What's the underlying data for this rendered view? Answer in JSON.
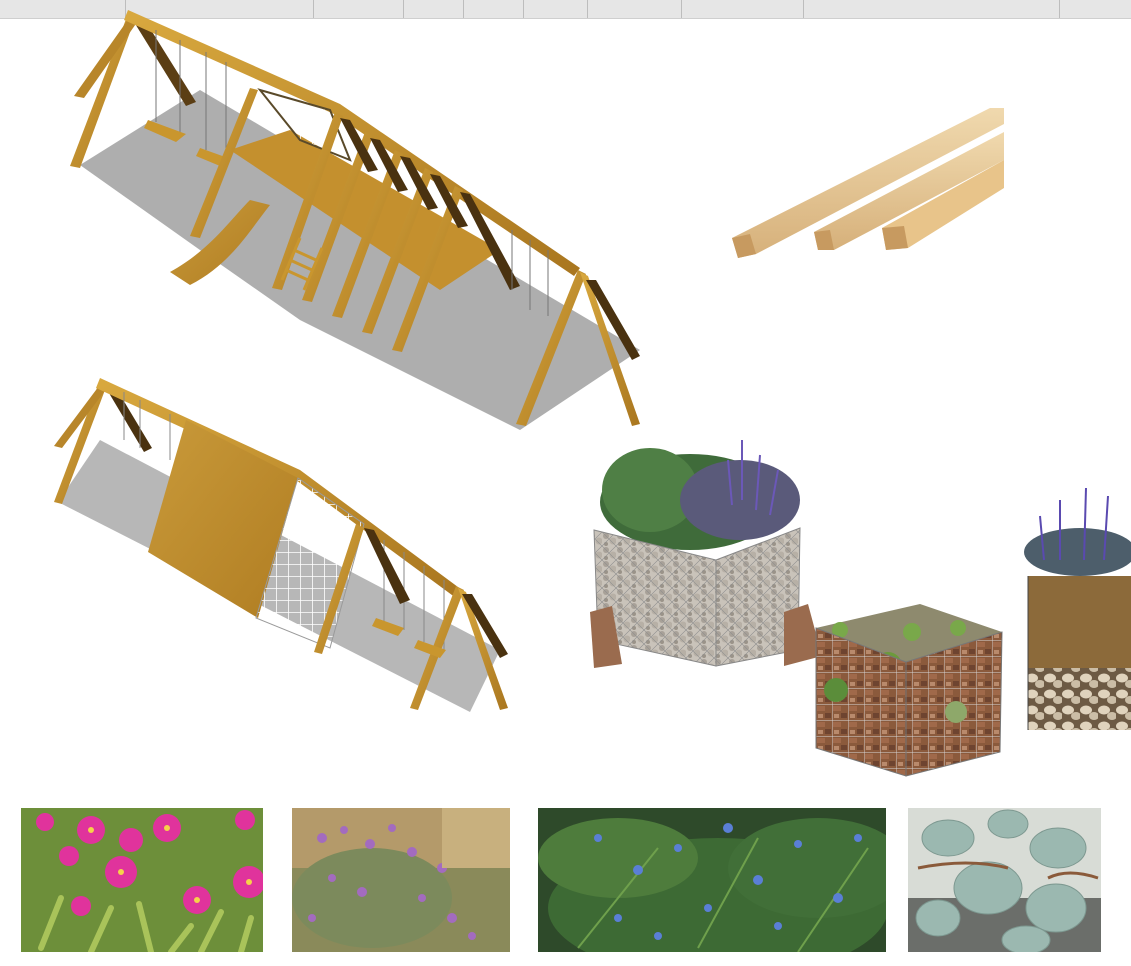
{
  "sheet": {
    "background_color": "#ffffff",
    "toolbar_color": "#e6e6e6"
  },
  "items": {
    "playground_structure_large": {
      "icon": "wooden-a-frame-play-structure",
      "wood_color": "#c9962e"
    },
    "playground_structure_small": {
      "icon": "wooden-a-frame-play-structure-with-net",
      "wood_color": "#c9962e"
    },
    "timber_boards": {
      "icon": "timber-planks",
      "wood_color": "#e2c08a"
    },
    "gabion_planters": {
      "icon": "gabion-planter-baskets",
      "stone_color": "#b8b2a8"
    }
  },
  "plant_photos": [
    {
      "icon": "ice-plant-flowers-photo",
      "accent": "#e0339c"
    },
    {
      "icon": "lavender-field-photo",
      "accent": "#a36bbf"
    },
    {
      "icon": "rosemary-shrub-photo",
      "accent": "#5a7fd6"
    },
    {
      "icon": "succulent-jade-plant-photo",
      "accent": "#9bb8b0"
    }
  ]
}
